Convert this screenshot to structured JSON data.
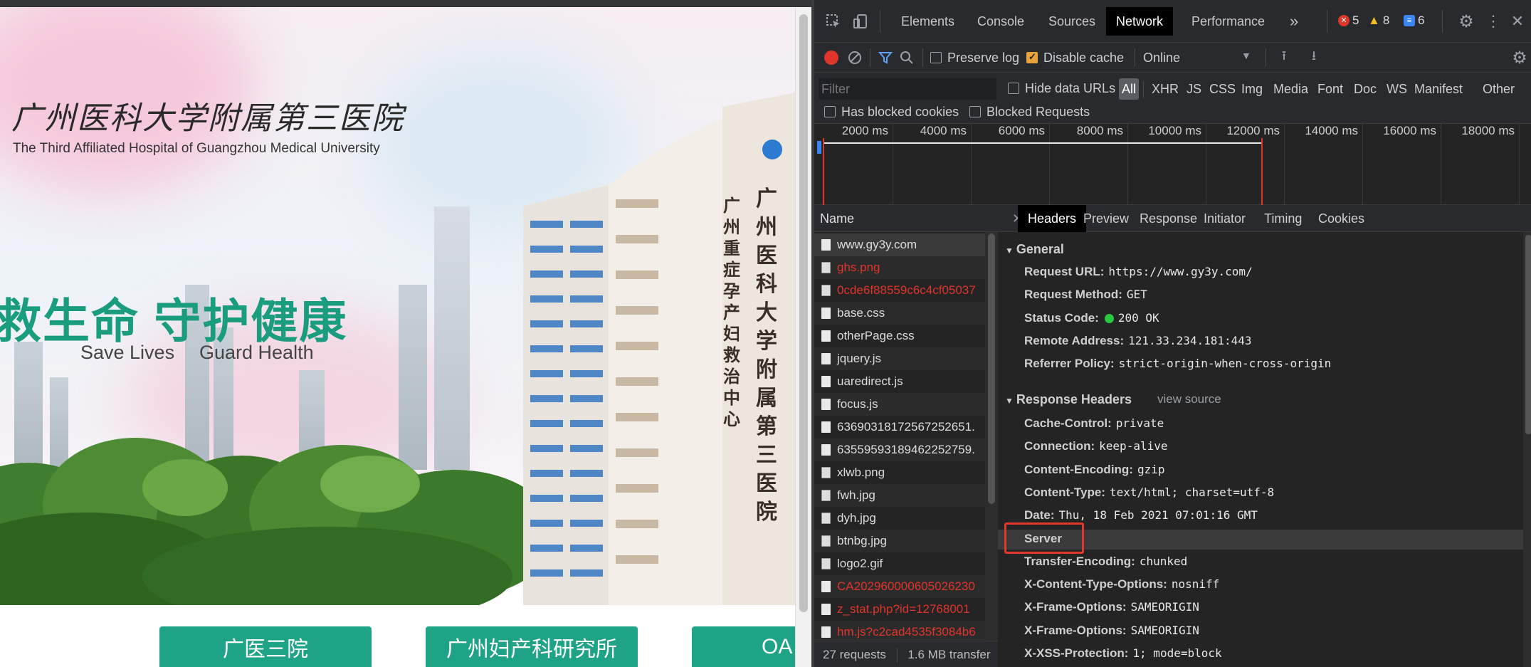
{
  "page": {
    "logo_cn": "广州医科大学附属第三医院",
    "logo_en": "The Third Affiliated Hospital of Guangzhou Medical University",
    "slogan_cn": "救生命 守护健康",
    "slogan_en_1": "Save Lives",
    "slogan_en_2": "Guard Health",
    "building_sign": "广州重症孕产妇救治中心",
    "building_sign_2": "广州医科大学附属第三医院",
    "nav_buttons": [
      "广医三院",
      "广州妇产科研究所",
      "OA"
    ]
  },
  "devtools": {
    "tabs": [
      "Elements",
      "Console",
      "Sources",
      "Network",
      "Performance"
    ],
    "active_tab": "Network",
    "more_tabs_icon": "»",
    "errors": "5",
    "warnings": "8",
    "messages": "6",
    "toolbar": {
      "preserve_log": "Preserve log",
      "disable_cache": "Disable cache",
      "throttling": "Online"
    },
    "filter": {
      "placeholder": "Filter",
      "hide_data_urls": "Hide data URLs",
      "types": [
        "All",
        "XHR",
        "JS",
        "CSS",
        "Img",
        "Media",
        "Font",
        "Doc",
        "WS",
        "Manifest",
        "Other"
      ],
      "active_type": "All",
      "has_blocked_cookies": "Has blocked cookies",
      "blocked_requests": "Blocked Requests"
    },
    "timeline_ticks": [
      "2000 ms",
      "4000 ms",
      "6000 ms",
      "8000 ms",
      "10000 ms",
      "12000 ms",
      "14000 ms",
      "16000 ms",
      "18000 ms"
    ],
    "name_header": "Name",
    "requests": [
      {
        "name": "www.gy3y.com",
        "err": false,
        "icon": "doc"
      },
      {
        "name": "ghs.png",
        "err": true,
        "icon": "img"
      },
      {
        "name": "0cde6f88559c6c4cf05037",
        "err": true,
        "icon": "img"
      },
      {
        "name": "base.css",
        "err": false,
        "icon": "doc"
      },
      {
        "name": "otherPage.css",
        "err": false,
        "icon": "doc"
      },
      {
        "name": "jquery.js",
        "err": false,
        "icon": "doc"
      },
      {
        "name": "uaredirect.js",
        "err": false,
        "icon": "doc"
      },
      {
        "name": "focus.js",
        "err": false,
        "icon": "doc"
      },
      {
        "name": "63690318172567252651.",
        "err": false,
        "icon": "doc"
      },
      {
        "name": "63559593189462252759.",
        "err": false,
        "icon": "doc"
      },
      {
        "name": "xlwb.png",
        "err": false,
        "icon": "img"
      },
      {
        "name": "fwh.jpg",
        "err": false,
        "icon": "img"
      },
      {
        "name": "dyh.jpg",
        "err": false,
        "icon": "img"
      },
      {
        "name": "btnbg.jpg",
        "err": false,
        "icon": "img"
      },
      {
        "name": "logo2.gif",
        "err": false,
        "icon": "img"
      },
      {
        "name": "CA202960000605026230",
        "err": true,
        "icon": "doc"
      },
      {
        "name": "z_stat.php?id=12768001",
        "err": true,
        "icon": "doc"
      },
      {
        "name": "hm.js?c2cad4535f3084b6",
        "err": true,
        "icon": "doc"
      }
    ],
    "status": {
      "requests": "27 requests",
      "transferred": "1.6 MB transfer"
    },
    "detail_tabs": [
      "Headers",
      "Preview",
      "Response",
      "Initiator",
      "Timing",
      "Cookies"
    ],
    "active_detail_tab": "Headers",
    "general_title": "General",
    "general": [
      {
        "k": "Request URL:",
        "v": "https://www.gy3y.com/"
      },
      {
        "k": "Request Method:",
        "v": "GET"
      },
      {
        "k": "Status Code:",
        "v": "200 OK"
      },
      {
        "k": "Remote Address:",
        "v": "121.33.234.181:443"
      },
      {
        "k": "Referrer Policy:",
        "v": "strict-origin-when-cross-origin"
      }
    ],
    "response_title": "Response Headers",
    "view_source": "view source",
    "response_headers": [
      {
        "k": "Cache-Control:",
        "v": "private"
      },
      {
        "k": "Connection:",
        "v": "keep-alive"
      },
      {
        "k": "Content-Encoding:",
        "v": "gzip"
      },
      {
        "k": "Content-Type:",
        "v": "text/html; charset=utf-8"
      },
      {
        "k": "Date:",
        "v": "Thu, 18 Feb 2021 07:01:16 GMT"
      },
      {
        "k": "Server",
        "v": ""
      },
      {
        "k": "Transfer-Encoding:",
        "v": "chunked"
      },
      {
        "k": "X-Content-Type-Options:",
        "v": "nosniff"
      },
      {
        "k": "X-Frame-Options:",
        "v": "SAMEORIGIN"
      },
      {
        "k": "X-Frame-Options:",
        "v": "SAMEORIGIN"
      },
      {
        "k": "X-XSS-Protection:",
        "v": "1; mode=block"
      }
    ],
    "colors": {
      "status_ok": "#27c93f",
      "error": "#e0352b",
      "accent_tab": "#000000",
      "highlight": "#e3372b"
    }
  }
}
